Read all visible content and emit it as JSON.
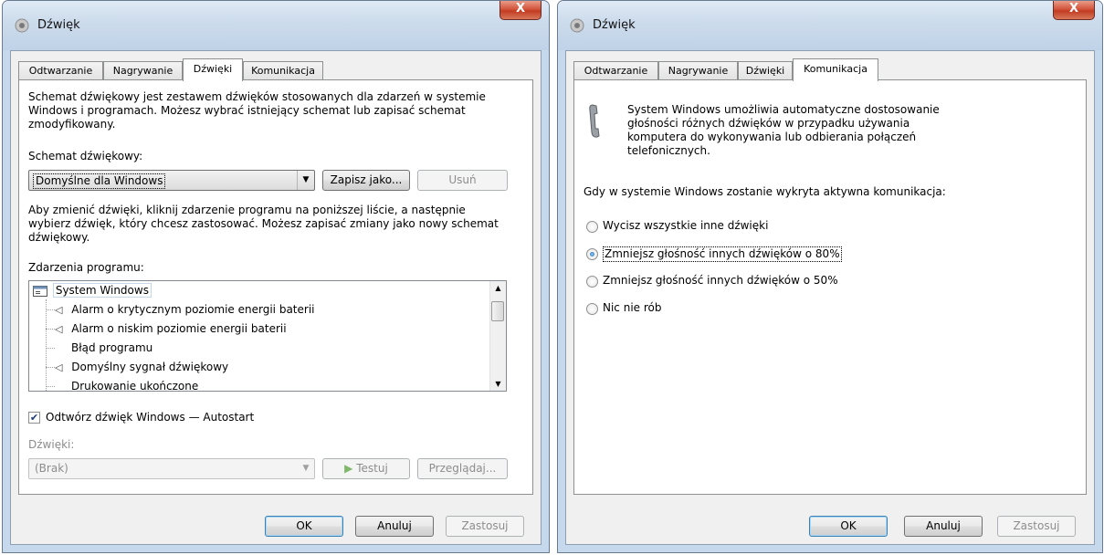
{
  "left": {
    "title": "Dźwięk",
    "close_label": "X",
    "tabs": [
      {
        "label": "Odtwarzanie"
      },
      {
        "label": "Nagrywanie"
      },
      {
        "label": "Dźwięki"
      },
      {
        "label": "Komunikacja"
      }
    ],
    "description": "Schemat dźwiękowy jest zestawem dźwięków stosowanych dla zdarzeń w systemie Windows i programach. Możesz wybrać istniejący schemat lub zapisać schemat zmodyfikowany.",
    "scheme_label": "Schemat dźwiękowy:",
    "scheme_value": "Domyślne dla Windows",
    "save_as_button": "Zapisz jako...",
    "delete_button": "Usuń",
    "help_text": "Aby zmienić dźwięki, kliknij zdarzenie programu na poniższej liście, a następnie wybierz dźwięk, który chcesz zastosować. Możesz zapisać zmiany jako nowy schemat dźwiękowy.",
    "events_label": "Zdarzenia programu:",
    "events": [
      {
        "label": "System Windows",
        "icon": "window-icon",
        "has_sound": false
      },
      {
        "label": "Alarm o krytycznym poziomie energii baterii",
        "icon": "speaker-icon",
        "has_sound": true
      },
      {
        "label": "Alarm o niskim poziomie energii baterii",
        "icon": "speaker-icon",
        "has_sound": true
      },
      {
        "label": "Błąd programu",
        "icon": "",
        "has_sound": false
      },
      {
        "label": "Domyślny sygnał dźwiękowy",
        "icon": "speaker-icon",
        "has_sound": true
      },
      {
        "label": "Drukowanie ukończone",
        "icon": "",
        "has_sound": false
      }
    ],
    "startup_checkbox_label": "Odtwórz dźwięk Windows — Autostart",
    "startup_checked": true,
    "sounds_label": "Dźwięki:",
    "sounds_value": "(Brak)",
    "test_button": "Testuj",
    "browse_button": "Przeglądaj...",
    "ok_button": "OK",
    "cancel_button": "Anuluj",
    "apply_button": "Zastosuj"
  },
  "right": {
    "title": "Dźwięk",
    "close_label": "X",
    "tabs": [
      {
        "label": "Odtwarzanie"
      },
      {
        "label": "Nagrywanie"
      },
      {
        "label": "Dźwięki"
      },
      {
        "label": "Komunikacja"
      }
    ],
    "description": "System Windows umożliwia automatyczne dostosowanie głośności różnych dźwięków w przypadku używania komputera do wykonywania lub odbierania połączeń telefonicznych.",
    "question": "Gdy w systemie Windows zostanie wykryta aktywna komunikacja:",
    "options": [
      {
        "label": "Wycisz wszystkie inne dźwięki",
        "selected": false
      },
      {
        "label": "Zmniejsz głośność innych dźwięków o 80%",
        "selected": true
      },
      {
        "label": "Zmniejsz głośność innych dźwięków o 50%",
        "selected": false
      },
      {
        "label": "Nic nie rób",
        "selected": false
      }
    ],
    "ok_button": "OK",
    "cancel_button": "Anuluj",
    "apply_button": "Zastosuj"
  }
}
